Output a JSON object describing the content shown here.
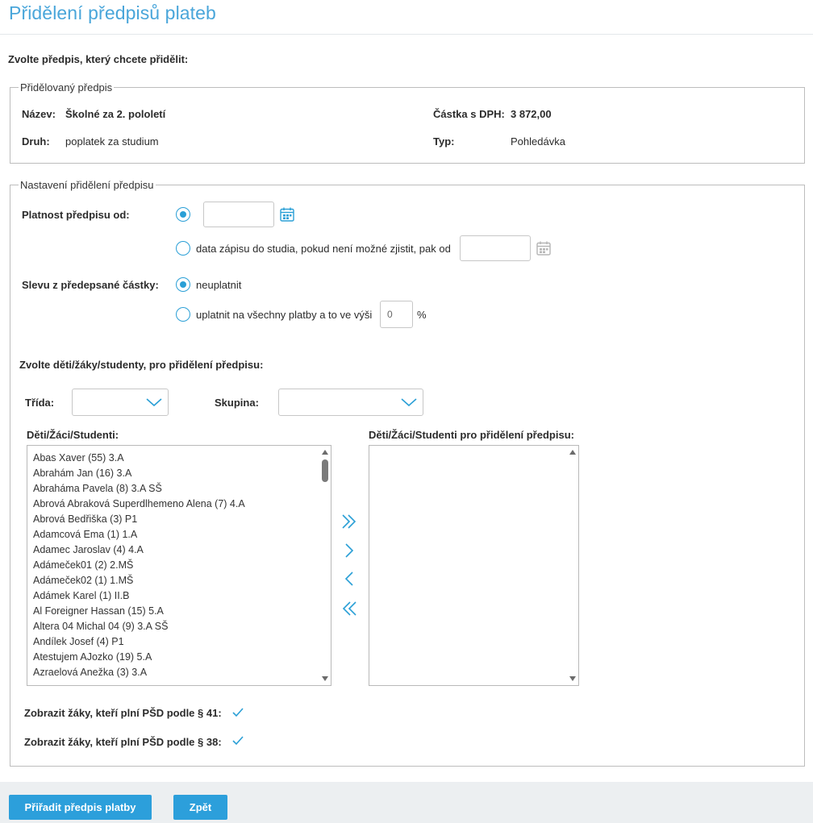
{
  "page": {
    "title": "Přidělení předpisů plateb",
    "intro": "Zvolte předpis, který chcete přidělit:"
  },
  "assigned": {
    "legend": "Přidělovaný předpis",
    "name_label": "Název:",
    "name_value": "Školné za 2. pololetí",
    "amount_label": "Částka s DPH:",
    "amount_value": "3 872,00",
    "kind_label": "Druh:",
    "kind_value": "poplatek za studium",
    "type_label": "Typ:",
    "type_value": "Pohledávka"
  },
  "settings": {
    "legend": "Nastavení přidělení předpisu",
    "validity_label": "Platnost předpisu od:",
    "validity_option2": "data zápisu do studia, pokud není možné zjistit, pak od",
    "validity_date1": "",
    "validity_date2": "",
    "discount_label": "Slevu z předepsané částky:",
    "discount_option1": "neuplatnit",
    "discount_option2": "uplatnit na všechny platby a to ve výši",
    "discount_value": "0",
    "discount_unit": "%",
    "students_heading": "Zvolte děti/žáky/studenty, pro přidělení předpisu:",
    "class_label": "Třída:",
    "class_value": "",
    "group_label": "Skupina:",
    "group_value": "",
    "available_label": "Děti/Žáci/Studenti:",
    "selected_label": "Děti/Žáci/Studenti pro přidělení předpisu:",
    "available_items": [
      "Abas Xaver (55) 3.A",
      "Abrahám Jan (16) 3.A",
      "Abraháma Pavela (8) 3.A SŠ",
      "Abrová Abraková Superdlhemeno Alena (7) 4.A",
      "Abrová Bedřiška (3) P1",
      "Adamcová Ema (1) 1.A",
      "Adamec Jaroslav (4) 4.A",
      "Adámeček01 (2) 2.MŠ",
      "Adámeček02 (1) 1.MŠ",
      "Adámek Karel (1) II.B",
      "Al Foreigner Hassan (15) 5.A",
      "Altera 04 Michal 04 (9) 3.A SŠ",
      "Andílek Josef (4) P1",
      "Atestujem AJozko (19) 5.A",
      "Azraelová Anežka (3) 3.A"
    ],
    "show_41_label": "Zobrazit žáky, kteří plní PŠD podle § 41:",
    "show_38_label": "Zobrazit žáky, kteří plní PŠD podle § 38:"
  },
  "footer": {
    "assign_button": "Přiřadit předpis platby",
    "back_button": "Zpět"
  },
  "colors": {
    "accent": "#2c9fdb",
    "title": "#4aa6da"
  }
}
